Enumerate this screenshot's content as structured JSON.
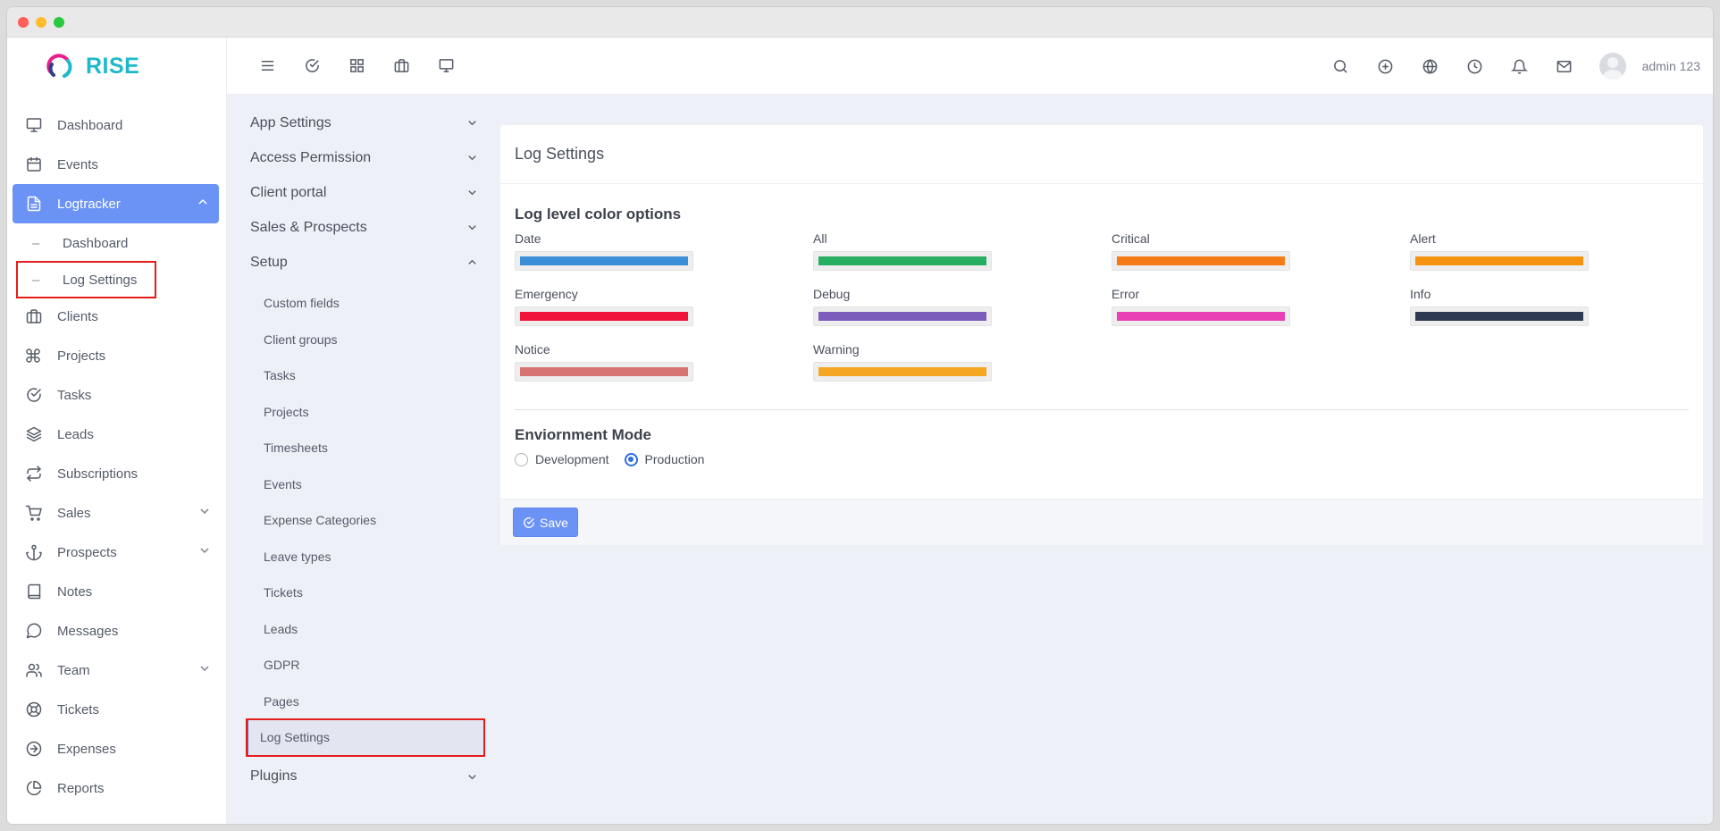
{
  "brand": {
    "name": "RISE"
  },
  "topbar": {
    "username": "admin 123"
  },
  "sidebar": {
    "items": [
      {
        "label": "Dashboard",
        "icon": "monitor-icon"
      },
      {
        "label": "Events",
        "icon": "calendar-icon"
      },
      {
        "label": "Logtracker",
        "icon": "document-icon",
        "active": true,
        "expanded": true
      },
      {
        "label": "Dashboard",
        "sub": true
      },
      {
        "label": "Log Settings",
        "sub": true,
        "highlighted": true
      },
      {
        "label": "Clients",
        "icon": "briefcase-icon"
      },
      {
        "label": "Projects",
        "icon": "command-icon"
      },
      {
        "label": "Tasks",
        "icon": "check-circle-icon"
      },
      {
        "label": "Leads",
        "icon": "layers-icon"
      },
      {
        "label": "Subscriptions",
        "icon": "repeat-icon"
      },
      {
        "label": "Sales",
        "icon": "cart-icon",
        "chevron": true
      },
      {
        "label": "Prospects",
        "icon": "anchor-icon",
        "chevron": true
      },
      {
        "label": "Notes",
        "icon": "book-icon"
      },
      {
        "label": "Messages",
        "icon": "message-icon"
      },
      {
        "label": "Team",
        "icon": "users-icon",
        "chevron": true
      },
      {
        "label": "Tickets",
        "icon": "lifebuoy-icon"
      },
      {
        "label": "Expenses",
        "icon": "arrow-circle-icon"
      },
      {
        "label": "Reports",
        "icon": "pie-chart-icon"
      }
    ]
  },
  "settings_menu": {
    "groups": [
      {
        "label": "App Settings"
      },
      {
        "label": "Access Permission"
      },
      {
        "label": "Client portal"
      },
      {
        "label": "Sales & Prospects"
      },
      {
        "label": "Setup"
      }
    ],
    "setup_items": [
      "Custom fields",
      "Client groups",
      "Tasks",
      "Projects",
      "Timesheets",
      "Events",
      "Expense Categories",
      "Leave types",
      "Tickets",
      "Leads",
      "GDPR",
      "Pages",
      "Log Settings"
    ],
    "plugins_label": "Plugins"
  },
  "page": {
    "title": "Log Settings",
    "color_section_title": "Log level color options",
    "colors": [
      {
        "label": "Date",
        "color": "#3a8fd8"
      },
      {
        "label": "All",
        "color": "#27ae60"
      },
      {
        "label": "Critical",
        "color": "#f57c14"
      },
      {
        "label": "Alert",
        "color": "#f5920f"
      },
      {
        "label": "Emergency",
        "color": "#f0143c"
      },
      {
        "label": "Debug",
        "color": "#7d5dbb"
      },
      {
        "label": "Error",
        "color": "#e940b6"
      },
      {
        "label": "Info",
        "color": "#2e3a4f"
      },
      {
        "label": "Notice",
        "color": "#d67474"
      },
      {
        "label": "Warning",
        "color": "#f5a623"
      }
    ],
    "env_title": "Enviornment Mode",
    "env_options": [
      {
        "label": "Development",
        "checked": false
      },
      {
        "label": "Production",
        "checked": true
      }
    ],
    "save_label": "Save"
  }
}
